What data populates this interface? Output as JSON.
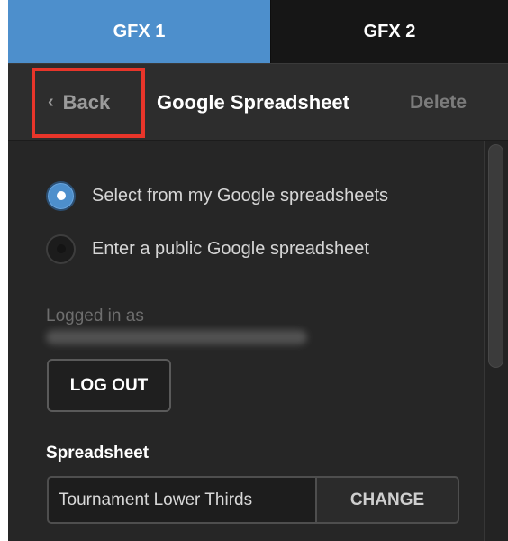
{
  "tabs": [
    {
      "label": "GFX 1",
      "active": true
    },
    {
      "label": "GFX 2",
      "active": false
    }
  ],
  "header": {
    "back_label": "Back",
    "title": "Google Spreadsheet",
    "delete_label": "Delete"
  },
  "source_options": {
    "selected": 0,
    "items": [
      {
        "label": "Select from my Google spreadsheets"
      },
      {
        "label": "Enter a public Google spreadsheet"
      }
    ]
  },
  "account": {
    "logged_in_label": "Logged in as",
    "logout_label": "LOG OUT"
  },
  "spreadsheet": {
    "section_label": "Spreadsheet",
    "value": "Tournament Lower Thirds",
    "change_label": "CHANGE"
  },
  "colors": {
    "accent": "#4d8fcc",
    "highlight_box": "#e8352a",
    "panel_bg": "#262626"
  },
  "icons": {
    "back": "chevron-left-icon"
  }
}
